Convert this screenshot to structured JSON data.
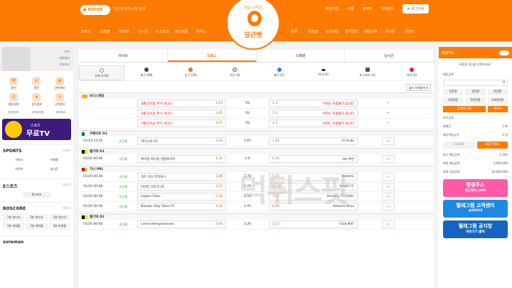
{
  "header": {
    "notice_label": "NOTICE",
    "notice_text": "당근벳 공지사항 안내",
    "top_links": [
      "회원가입",
      "쿠폰",
      "출석부",
      "고객센터"
    ],
    "login_label": "로그아웃",
    "nav_left": [
      "크로스",
      "스페셜",
      "라이브",
      "실시간",
      "E-스포츠",
      "미니게임",
      "카지노"
    ],
    "nav_right": [
      "슬롯",
      "파워볼",
      "토큰게임",
      "경기결과",
      "배팅내역",
      "게시판",
      "이벤트"
    ],
    "logo_sub": "당신 근처의",
    "logo_name": "당근벳"
  },
  "sidebar_left": {
    "profile_rows": [
      "유저",
      "회원정보",
      "보유머니"
    ],
    "quick": [
      "충전",
      "환전",
      "간편계좌",
      "배팅내역",
      "경기결과",
      "고객센터"
    ],
    "small_links": [
      "추천인코드",
      "포인트전환",
      "출석체크"
    ],
    "banner": {
      "t1": "스포츠",
      "t2": "무료TV"
    },
    "sports_title": "SPORTS",
    "sports_more": "더보기",
    "sports": [
      "크로스",
      "스페셜",
      "라이브",
      "실시간"
    ],
    "esports_title": "E스포츠",
    "esports_more": "더보기",
    "esports_pill": "E스포츠",
    "boscore_title": "BOSCORE",
    "boscore_more": "더보기",
    "boscore": [
      "1분 윈드라",
      "2분 윈드라",
      "3분 윈드라",
      "1분 파워볼",
      "2분 파워볼",
      "3분 파워볼"
    ],
    "sureman": "sureman"
  },
  "main": {
    "tabs": [
      "라이브",
      "크로스",
      "스페셜",
      "실시간"
    ],
    "sport_tabs": [
      "전체 (119)",
      "축구 (69)",
      "농구 (10)",
      "야구 (0)",
      "배구 (5)",
      "하키 (0)",
      "E-스포츠 (5)",
      "기타 (2)"
    ],
    "view_btn": "폴더 전체펼치기",
    "bonus_league": "보너스배당",
    "bonus_rows": [
      {
        "home": "3폴더 이상 추가 보너스",
        "ho": "1.03",
        "vs": "VS",
        "ao": "1.3",
        "away": "이하는 조합불가 입니다"
      },
      {
        "home": "5폴더 이상 추가 보너스",
        "ho": "1.05",
        "vs": "VS",
        "ao": "1.3",
        "away": "이하는 조합불가 입니다"
      },
      {
        "home": "7폴더 이상 추가 보너스",
        "ho": "1.07",
        "vs": "VS",
        "ao": "1.3",
        "away": "이하는 조합불가 입니다"
      }
    ],
    "leagues": [
      {
        "name": "쿠웨이트 D1",
        "f1": "#007a3d",
        "f2": "#fff",
        "matches": [
          {
            "time": "01/19 23:45",
            "mk": "승무패",
            "home": "카디시야 SC",
            "ho": "3.63",
            "draw": "2.87",
            "ao": "1.94",
            "away": "Al Arabi",
            "more": "+5"
          }
        ]
      },
      {
        "name": "벨기에 D1",
        "f1": "#000",
        "f2": "#fdda24",
        "matches": [
          {
            "time": "01/20 00:00",
            "mk": "승무패",
            "home": "루아얄 위니옹 생질루아즈",
            "ho": "1.41",
            "draw": "4.4",
            "ao": "6.41",
            "away": "OH 루번",
            "more": "+5"
          }
        ]
      },
      {
        "name": "가나 PRL",
        "f1": "#ce1126",
        "f2": "#fcd116",
        "matches": [
          {
            "time": "01/20 00:00",
            "mk": "승무패",
            "home": "하트 오브 라이온스",
            "ho": "1.86",
            "draw": "2.78",
            "ao": "5.11",
            "away": "Nations",
            "more": "+5"
          },
          {
            "time": "01/20 00:00",
            "mk": "승무패",
            "home": "아샨티 고트크 SC",
            "ho": "1.27",
            "draw": "3.78",
            "ao": "10.06",
            "away": "Vision FC",
            "more": "+5"
          },
          {
            "time": "01/20 00:00",
            "mk": "승무패",
            "home": "Legon Cities",
            "ho": "2.38",
            "draw": "2.33",
            "ao": "3.17",
            "away": "Dreams FC(GHA)",
            "more": "+5"
          },
          {
            "time": "01/20 00:00",
            "mk": "승무패",
            "home": "Basake Holy Stars FC",
            "ho": "1.51",
            "draw": "2.95",
            "ao": "6.46",
            "away": "Aduana Stars",
            "more": "+5"
          }
        ]
      },
      {
        "name": "벨기에 D2",
        "f1": "#000",
        "f2": "#fdda24",
        "matches": [
          {
            "time": "01/20 00:00",
            "mk": "승무패",
            "home": "Lierse Kempenzonen",
            "ho": "2.00",
            "draw": "3.26",
            "ao": "3.27",
            "away": "Club NXT",
            "more": "+5"
          }
        ]
      }
    ],
    "watermark": "먹튀스팟"
  },
  "sidebar_right": {
    "title": "배팅카트",
    "select_msg": "배팅할 게임을 선택하세요!",
    "bet_amount_label": "배팅금액",
    "bet_amount": "0",
    "amounts": [
      "5천원",
      "1만원",
      "5만원",
      "10만원",
      "50만원",
      "100만원",
      "금액초기화",
      "MAX"
    ],
    "holdings_label": "보유금액",
    "holdings": "",
    "odds_label": "총배당",
    "odds": "1 배",
    "expected_label": "예상적중금액",
    "expected": "0 원",
    "clear": "CLEAR",
    "betting": "BETTING",
    "limits": [
      {
        "k": "최소 배팅금액:",
        "v": "5,000"
      },
      {
        "k": "최대 배팅금액:",
        "v": "3,000,000"
      },
      {
        "k": "최대 당첨금액:",
        "v": "30,000,000"
      }
    ],
    "ads": [
      {
        "t": "평생주소",
        "s": "당근접속.COM",
        "c": "#ff5aa8"
      },
      {
        "t": "텔레그램 고객센터",
        "s": "@DGI19",
        "c": "#1e88e5"
      },
      {
        "t": "텔레그램 공지방",
        "s": "바로가기 클릭",
        "c": "#1565c0"
      }
    ]
  }
}
